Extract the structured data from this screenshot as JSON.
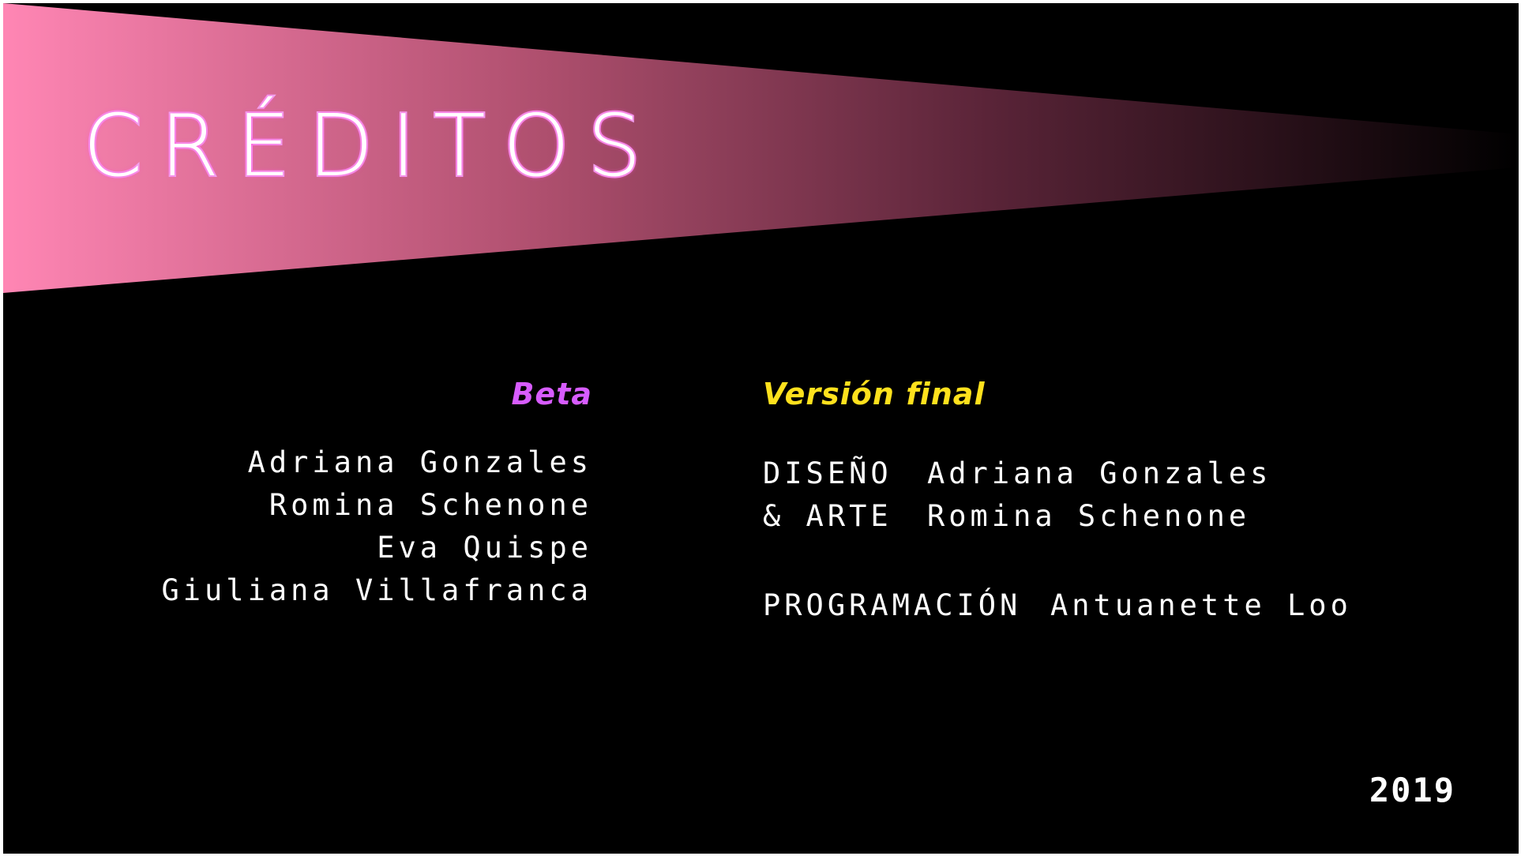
{
  "title": "CRÉDITOS",
  "beta": {
    "heading": "Beta",
    "names": [
      "Adriana Gonzales",
      "Romina Schenone",
      "Eva Quispe",
      "Giuliana Villafranca"
    ]
  },
  "final": {
    "heading": "Versión final",
    "design": {
      "label_line1": "DISEÑO",
      "label_line2": "& ARTE",
      "names": [
        "Adriana Gonzales",
        "Romina Schenone"
      ]
    },
    "programming": {
      "label": "PROGRAMACIÓN",
      "name": "Antuanette Loo"
    }
  },
  "year": "2019",
  "colors": {
    "background": "#000000",
    "beam_start": "#ff86b4",
    "beam_end": "#000000",
    "beta_heading": "#d75cff",
    "final_heading": "#ffe11d",
    "text": "#ffffff"
  }
}
